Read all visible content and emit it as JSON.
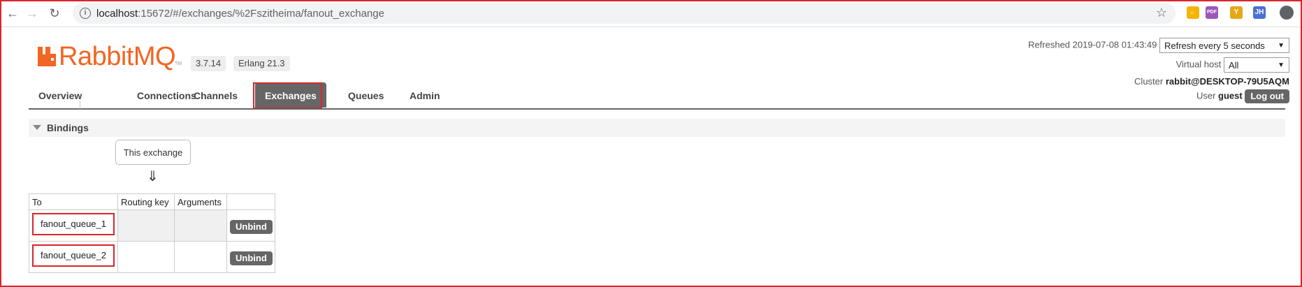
{
  "browser": {
    "url_host": "localhost",
    "url_rest": ":15672/#/exchanges/%2Fszitheima/fanout_exchange",
    "back_glyph": "←",
    "forward_glyph": "→",
    "reload_glyph": "↻",
    "star_glyph": "☆",
    "info_glyph": "i",
    "extensions": [
      {
        "name": "hand-extension-icon",
        "glyph": "✋",
        "color": "#f5b400"
      },
      {
        "name": "pdf-extension-icon",
        "glyph": "PDF",
        "color": "#9b59b6"
      },
      {
        "name": "y-extension-icon",
        "glyph": "Y",
        "color": "#e6a817"
      },
      {
        "name": "jh-extension-icon",
        "glyph": "JH",
        "color": "#4a6fd6"
      }
    ]
  },
  "app": {
    "logo_text": "RabbitMQ",
    "logo_tm": "TM",
    "brand_color": "#f26522",
    "version": "3.7.14",
    "erlang": "Erlang 21.3"
  },
  "header": {
    "refreshed_label": "Refreshed 2019-07-08 01:43:49",
    "refresh_select": "Refresh every 5 seconds",
    "vhost_label": "Virtual host",
    "vhost_select": "All",
    "cluster_label": "Cluster",
    "cluster_name": "rabbit@DESKTOP-79U5AQM",
    "user_label": "User",
    "user_name": "guest",
    "logout_label": "Log out"
  },
  "tabs": [
    {
      "label": "Overview",
      "active": false
    },
    {
      "label": "Connections",
      "active": false
    },
    {
      "label": "Channels",
      "active": false
    },
    {
      "label": "Exchanges",
      "active": true
    },
    {
      "label": "Queues",
      "active": false
    },
    {
      "label": "Admin",
      "active": false
    }
  ],
  "bindings": {
    "section_title": "Bindings",
    "this_exchange": "This exchange",
    "arrow": "⇓",
    "columns": [
      "To",
      "Routing key",
      "Arguments",
      ""
    ],
    "rows": [
      {
        "to": "fanout_queue_1",
        "routing_key": "",
        "arguments": "",
        "action": "Unbind"
      },
      {
        "to": "fanout_queue_2",
        "routing_key": "",
        "arguments": "",
        "action": "Unbind"
      }
    ]
  }
}
